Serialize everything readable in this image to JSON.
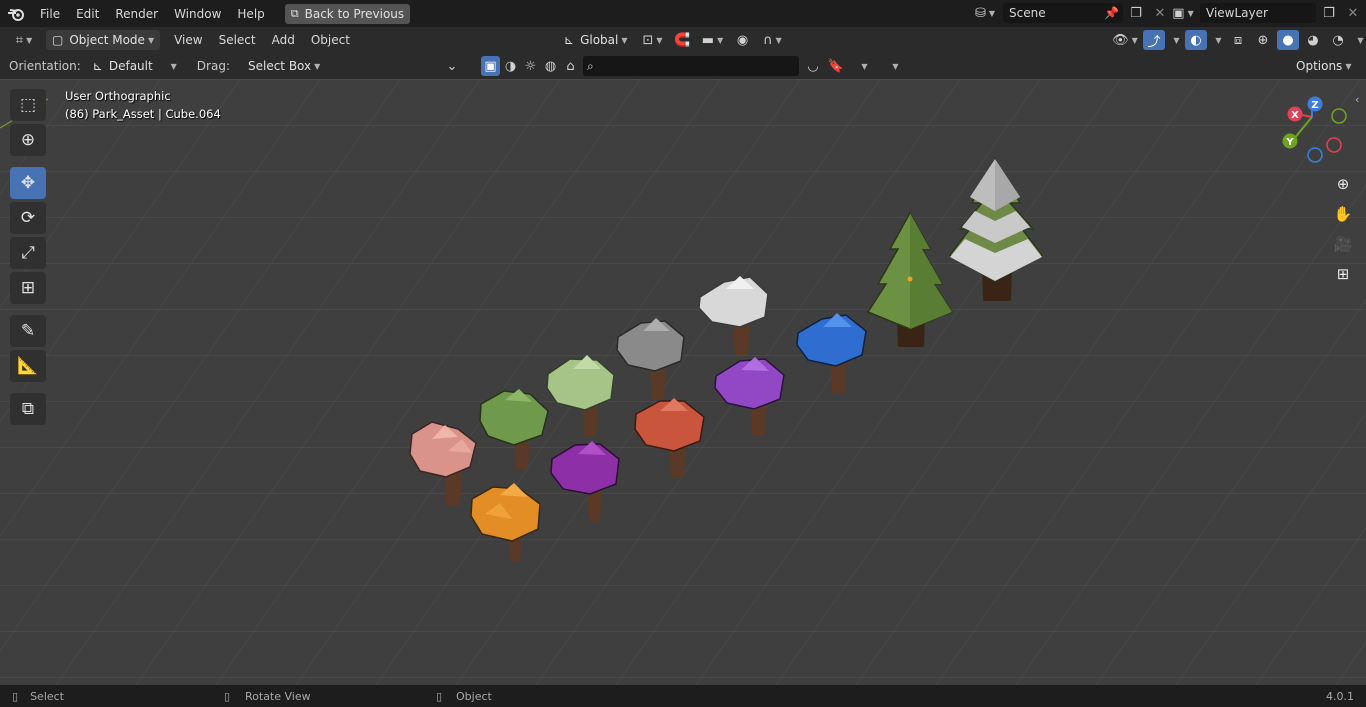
{
  "menubar": {
    "logo_icon": "blender-logo-icon",
    "menus": [
      "File",
      "Edit",
      "Render",
      "Window",
      "Help"
    ],
    "back_button": "Back to Previous",
    "scene_label": "Scene",
    "viewlayer_label": "ViewLayer"
  },
  "header": {
    "mode": "Object Mode",
    "menus": [
      "View",
      "Select",
      "Add",
      "Object"
    ],
    "transform_orientation": "Global"
  },
  "tool_settings": {
    "orientation_label": "Orientation:",
    "orientation_value": "Default",
    "drag_label": "Drag:",
    "drag_value": "Select Box",
    "search_placeholder": "",
    "options_label": "Options"
  },
  "viewport": {
    "view_name": "User Orthographic",
    "object_info": "(86) Park_Asset | Cube.064",
    "gizmo_axes": [
      "X",
      "Y",
      "Z"
    ]
  },
  "status_bar": {
    "items": [
      "Select",
      "Rotate View",
      "Object"
    ],
    "version": "4.0.1"
  },
  "colors": {
    "accent": "#4772b3",
    "x_axis": "#e14158",
    "y_axis": "#6ea51c",
    "z_axis": "#3c7fe0"
  }
}
